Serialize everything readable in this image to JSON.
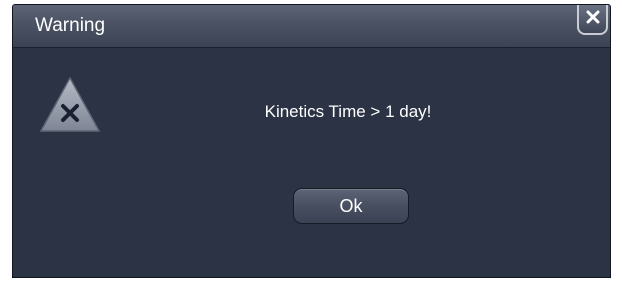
{
  "window": {
    "title": "Warning"
  },
  "dialog": {
    "message": "Kinetics Time > 1 day!",
    "ok_label": "Ok"
  },
  "icons": {
    "close": "close-icon",
    "warning": "warning-triangle-icon"
  },
  "colors": {
    "background": "#2b3345",
    "titlebar": "#4a5264",
    "text": "#ffffff",
    "triangle": "#9aa0ad"
  }
}
